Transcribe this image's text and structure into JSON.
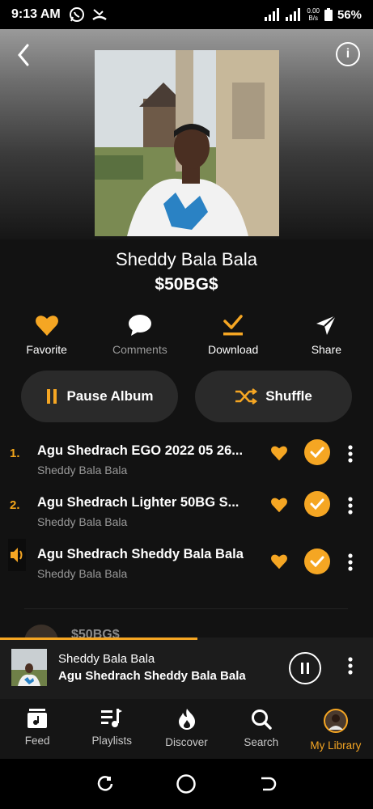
{
  "status_bar": {
    "time": "9:13 AM",
    "net_speed_value": "0.00",
    "net_speed_unit": "B/s",
    "battery": "56%"
  },
  "album": {
    "title": "Sheddy Bala Bala",
    "artist": "$50BG$"
  },
  "actions": [
    {
      "label": "Favorite",
      "icon": "heart-icon",
      "active": true
    },
    {
      "label": "Comments",
      "icon": "comment-icon",
      "active": false
    },
    {
      "label": "Download",
      "icon": "download-icon",
      "active": true
    },
    {
      "label": "Share",
      "icon": "share-icon",
      "active": false
    }
  ],
  "buttons": {
    "pause_album": "Pause Album",
    "shuffle": "Shuffle"
  },
  "tracks": [
    {
      "number": "1.",
      "title": "Agu Shedrach   EGO 2022 05 26...",
      "artist": "Sheddy Bala Bala",
      "playing": false
    },
    {
      "number": "2.",
      "title": "Agu Shedrach   Lighter  50BG S...",
      "artist": "Sheddy Bala Bala",
      "playing": false
    },
    {
      "number": "",
      "title": "Agu Shedrach   Sheddy Bala Bala",
      "artist": "Sheddy Bala Bala",
      "playing": true
    }
  ],
  "peek": {
    "artist": "$50BG$"
  },
  "now_playing": {
    "line1": "Sheddy Bala Bala",
    "line2": "Agu Shedrach   Sheddy Bala Bala",
    "progress": 0.53
  },
  "bottom_nav": [
    {
      "label": "Feed",
      "icon": "feed-icon",
      "active": false
    },
    {
      "label": "Playlists",
      "icon": "playlists-icon",
      "active": false
    },
    {
      "label": "Discover",
      "icon": "flame-icon",
      "active": false
    },
    {
      "label": "Search",
      "icon": "search-icon",
      "active": false
    },
    {
      "label": "My Library",
      "icon": "avatar-icon",
      "active": true
    }
  ],
  "colors": {
    "accent": "#f5a623",
    "background": "#121212"
  }
}
